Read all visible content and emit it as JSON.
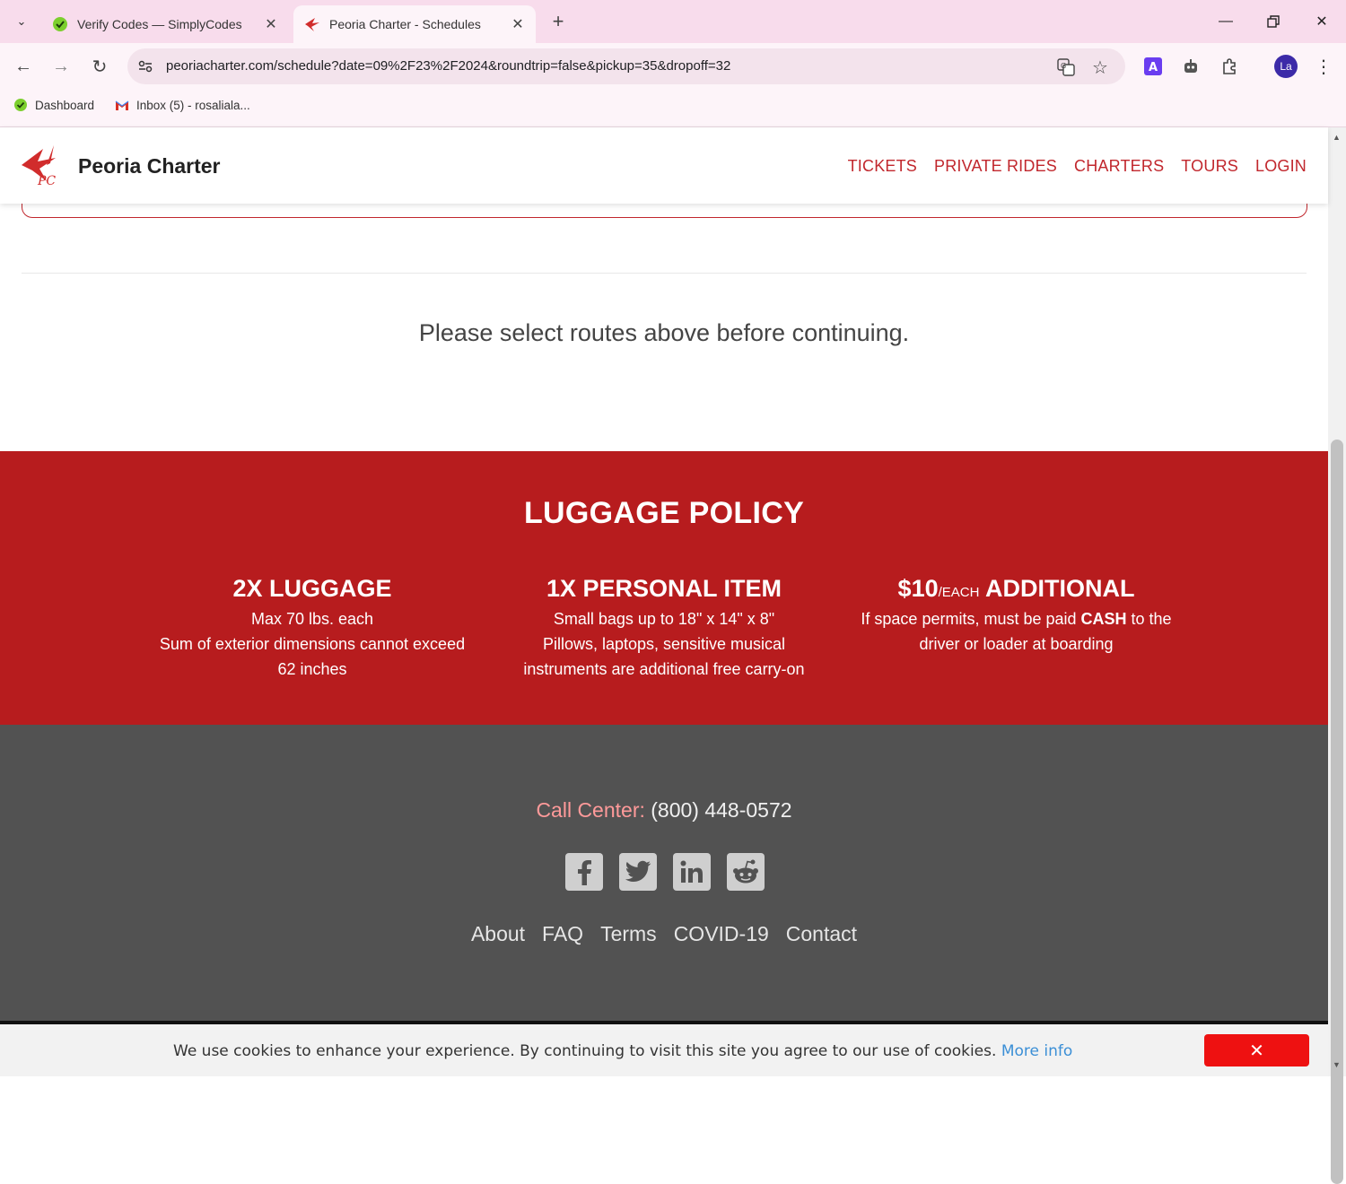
{
  "browser": {
    "tabs": [
      {
        "title": "Verify Codes — SimplyCodes",
        "active": false
      },
      {
        "title": "Peoria Charter - Schedules",
        "active": true
      }
    ],
    "url": "peoriacharter.com/schedule?date=09%2F23%2F2024&roundtrip=false&pickup=35&dropoff=32",
    "profile_initials": "La",
    "bookmarks": [
      {
        "label": "Dashboard"
      },
      {
        "label": "Inbox (5) - rosaliala..."
      }
    ],
    "colors": {
      "accent": "#c1272d",
      "tab_bar": "#f8dcec"
    }
  },
  "site": {
    "brand": "Peoria Charter",
    "nav": [
      "TICKETS",
      "PRIVATE RIDES",
      "CHARTERS",
      "TOURS",
      "LOGIN"
    ],
    "select_message": "Please select routes above before continuing."
  },
  "luggage": {
    "title": "LUGGAGE POLICY",
    "col1": {
      "heading": "2X LUGGAGE",
      "line1": "Max 70 lbs. each",
      "line2": "Sum of exterior dimensions cannot exceed",
      "line3": "62 inches"
    },
    "col2": {
      "heading": "1X PERSONAL ITEM",
      "line1": "Small bags up to 18\" x 14\" x 8\"",
      "line2": "Pillows, laptops, sensitive musical",
      "line3": "instruments are additional free carry-on"
    },
    "col3": {
      "heading_price": "$10",
      "heading_unit": "/EACH",
      "heading_rest": "ADDITIONAL",
      "line1_a": "If space permits, must be paid ",
      "line1_bold": "CASH",
      "line1_b": " to the",
      "line2": "driver or loader at boarding"
    }
  },
  "footer": {
    "call_label": "Call Center:",
    "phone": "(800) 448-0572",
    "socials": [
      "facebook-icon",
      "twitter-icon",
      "linkedin-icon",
      "reddit-icon"
    ],
    "links": [
      "About",
      "FAQ",
      "Terms",
      "COVID-19",
      "Contact"
    ]
  },
  "cookie": {
    "message": "We use cookies to enhance your experience. By continuing to visit this site you agree to our use of cookies.",
    "more_info": "More info",
    "close_label": "✕"
  }
}
